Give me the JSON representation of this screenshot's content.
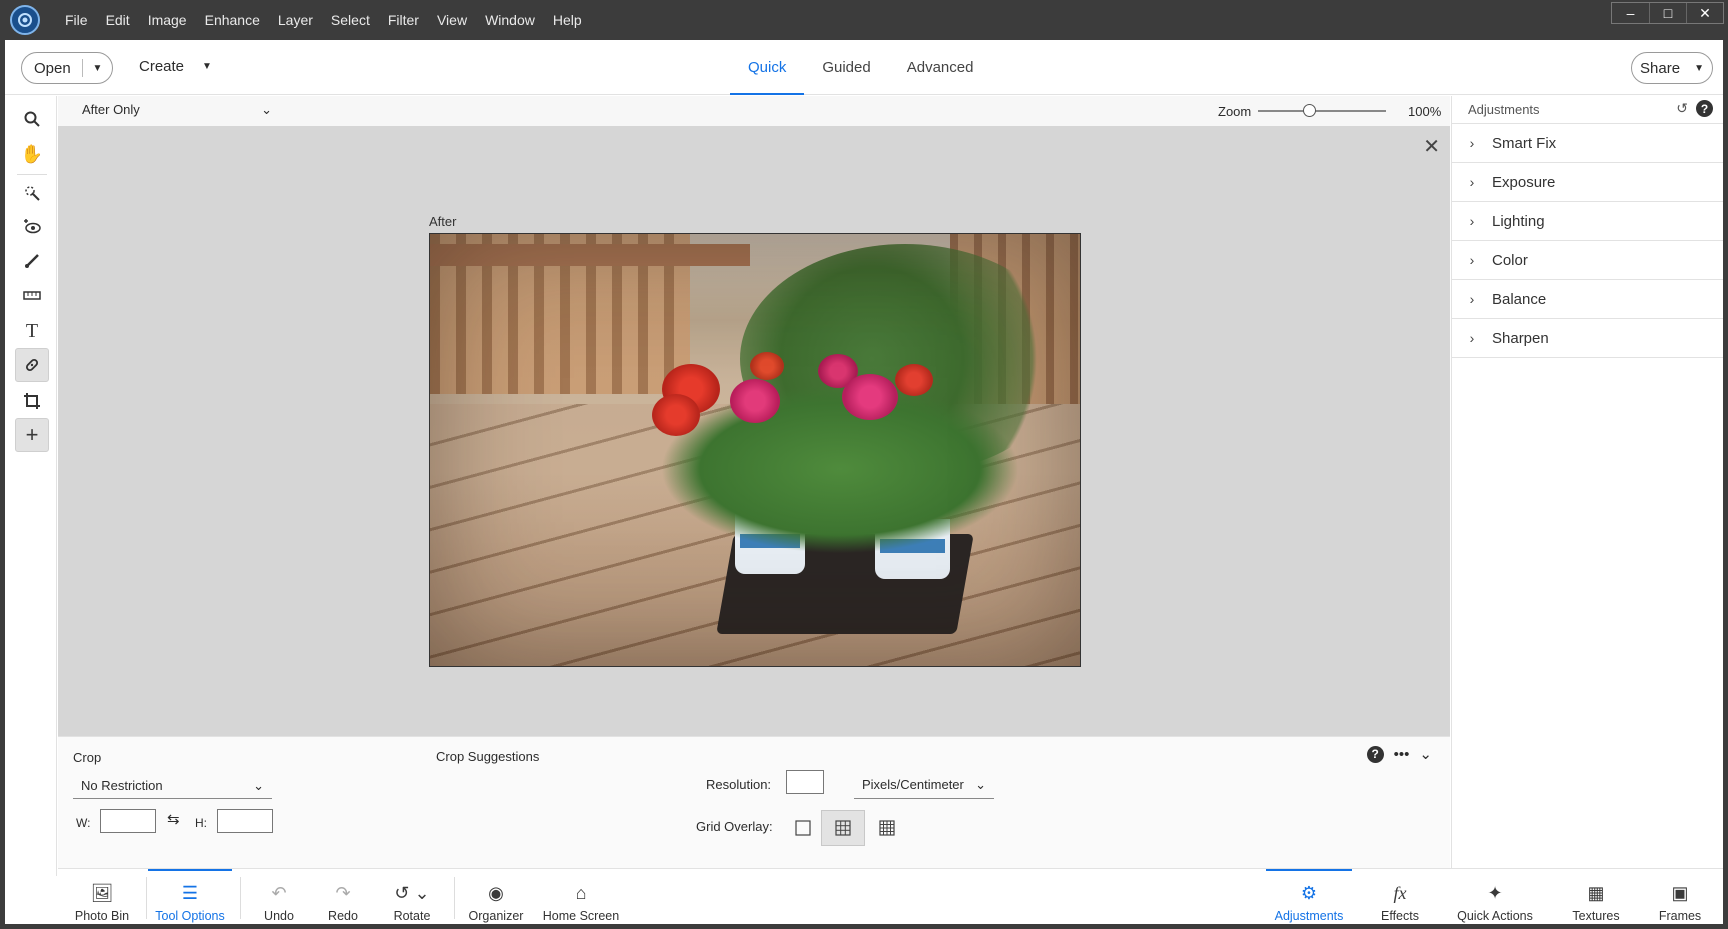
{
  "menubar": [
    "File",
    "Edit",
    "Image",
    "Enhance",
    "Layer",
    "Select",
    "Filter",
    "View",
    "Window",
    "Help"
  ],
  "window_controls": {
    "minimize": "–",
    "maximize": "□",
    "close": "✕"
  },
  "toolbar": {
    "open_label": "Open",
    "create_label": "Create",
    "modes": [
      "Quick",
      "Guided",
      "Advanced"
    ],
    "active_mode": "Quick",
    "share_label": "Share"
  },
  "view": {
    "mode": "After Only",
    "zoom_label": "Zoom",
    "zoom_value": "100%",
    "zoom_fraction": 0.4
  },
  "canvas": {
    "after_label": "After"
  },
  "adjustments": {
    "title": "Adjustments",
    "items": [
      "Smart Fix",
      "Exposure",
      "Lighting",
      "Color",
      "Balance",
      "Sharpen"
    ]
  },
  "tool_options": {
    "crop_label": "Crop",
    "aspect": "No Restriction",
    "w_label": "W:",
    "h_label": "H:",
    "suggestions_label": "Crop Suggestions",
    "resolution_label": "Resolution:",
    "units": "Pixels/Centimeter",
    "grid_overlay_label": "Grid Overlay:"
  },
  "taskbar": {
    "left": [
      "Photo Bin",
      "Tool Options",
      "Undo",
      "Redo",
      "Rotate",
      "Organizer",
      "Home Screen"
    ],
    "right": [
      "Adjustments",
      "Effects",
      "Quick Actions",
      "Textures",
      "Frames"
    ]
  },
  "colors": {
    "accent": "#1473e6",
    "titlebar": "#3c3c3c",
    "canvas": "#d6d6d6"
  }
}
